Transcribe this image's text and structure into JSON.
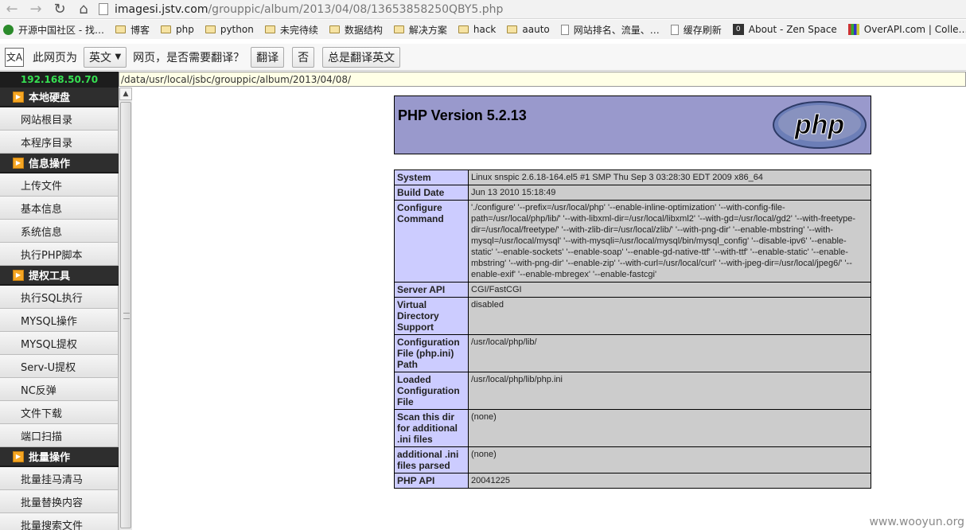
{
  "browser": {
    "url_host": "imagesi.jstv.com",
    "url_path": "/grouppic/album/2013/04/08/13653858250QBY5.php",
    "bookmarks": [
      {
        "label": "开源中国社区 - 找…",
        "icon": "green"
      },
      {
        "label": "博客",
        "icon": "folder"
      },
      {
        "label": "php",
        "icon": "folder"
      },
      {
        "label": "python",
        "icon": "folder"
      },
      {
        "label": "未完待续",
        "icon": "folder"
      },
      {
        "label": "数据结构",
        "icon": "folder"
      },
      {
        "label": "解决方案",
        "icon": "folder"
      },
      {
        "label": "hack",
        "icon": "folder"
      },
      {
        "label": "aauto",
        "icon": "folder"
      },
      {
        "label": "网站排名、流量、…",
        "icon": "page"
      },
      {
        "label": "缓存刷新",
        "icon": "page"
      },
      {
        "label": "About - Zen Space",
        "icon": "zen"
      },
      {
        "label": "OverAPI.com | Colle…",
        "icon": "stripes"
      }
    ],
    "translate": {
      "prefix": "此网页为",
      "language": "英文",
      "question": "网页，是否需要翻译？",
      "translate_btn": "翻译",
      "no_btn": "否",
      "always_btn": "总是翻译英文"
    }
  },
  "shell": {
    "ip": "192.168.50.70",
    "current_dir": "/data/usr/local/jsbc/grouppic/album/2013/04/08/",
    "sidebar": [
      {
        "type": "section",
        "label": "本地硬盘"
      },
      {
        "type": "item",
        "label": "网站根目录"
      },
      {
        "type": "item",
        "label": "本程序目录"
      },
      {
        "type": "section",
        "label": "信息操作"
      },
      {
        "type": "item",
        "label": "上传文件"
      },
      {
        "type": "item",
        "label": "基本信息"
      },
      {
        "type": "item",
        "label": "系统信息"
      },
      {
        "type": "item",
        "label": "执行PHP脚本"
      },
      {
        "type": "section",
        "label": "提权工具"
      },
      {
        "type": "item",
        "label": "执行SQL执行"
      },
      {
        "type": "item",
        "label": "MYSQL操作"
      },
      {
        "type": "item",
        "label": "MYSQL提权"
      },
      {
        "type": "item",
        "label": "Serv-U提权"
      },
      {
        "type": "item",
        "label": "NC反弹"
      },
      {
        "type": "item",
        "label": "文件下载"
      },
      {
        "type": "item",
        "label": "端口扫描"
      },
      {
        "type": "section",
        "label": "批量操作"
      },
      {
        "type": "item",
        "label": "批量挂马清马"
      },
      {
        "type": "item",
        "label": "批量替换内容"
      },
      {
        "type": "item",
        "label": "批量搜索文件"
      }
    ]
  },
  "phpinfo": {
    "title": "PHP Version 5.2.13",
    "logo_text": "php",
    "rows": [
      {
        "key": "System",
        "value": "Linux snspic 2.6.18-164.el5 #1 SMP Thu Sep 3 03:28:30 EDT 2009 x86_64"
      },
      {
        "key": "Build Date",
        "value": "Jun 13 2010 15:18:49"
      },
      {
        "key": "Configure Command",
        "value": "'./configure' '--prefix=/usr/local/php' '--enable-inline-optimization' '--with-config-file-path=/usr/local/php/lib/' '--with-libxml-dir=/usr/local/libxml2' '--with-gd=/usr/local/gd2' '--with-freetype-dir=/usr/local/freetype/' '--with-zlib-dir=/usr/local/zlib/' '--with-png-dir' '--enable-mbstring' '--with-mysql=/usr/local/mysql' '--with-mysqli=/usr/local/mysql/bin/mysql_config' '--disable-ipv6' '--enable-static' '--enable-sockets' '--enable-soap' '--enable-gd-native-ttf' '--with-ttf' '--enable-static' '--enable-mbstring' '--with-png-dir' '--enable-zip' '--with-curl=/usr/local/curl' '--with-jpeg-dir=/usr/local/jpeg6/' '--enable-exif' '--enable-mbregex' '--enable-fastcgi'"
      },
      {
        "key": "Server API",
        "value": "CGI/FastCGI"
      },
      {
        "key": "Virtual Directory Support",
        "value": "disabled"
      },
      {
        "key": "Configuration File (php.ini) Path",
        "value": "/usr/local/php/lib/"
      },
      {
        "key": "Loaded Configuration File",
        "value": "/usr/local/php/lib/php.ini"
      },
      {
        "key": "Scan this dir for additional .ini files",
        "value": "(none)"
      },
      {
        "key": "additional .ini files parsed",
        "value": "(none)"
      },
      {
        "key": "PHP API",
        "value": "20041225"
      }
    ]
  },
  "watermark": "www.wooyun.org"
}
